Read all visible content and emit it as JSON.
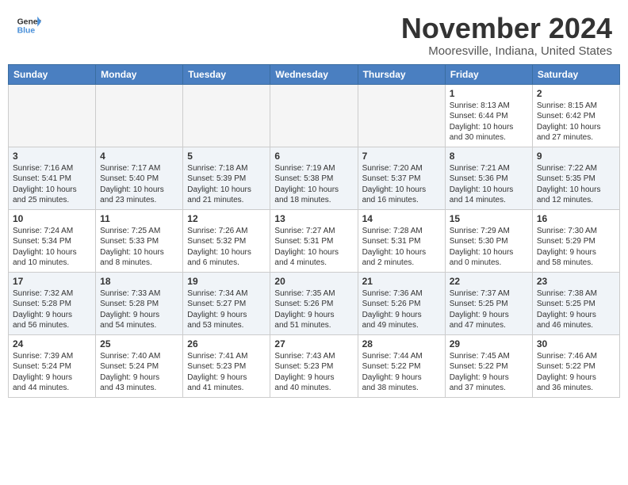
{
  "header": {
    "logo_line1": "General",
    "logo_line2": "Blue",
    "month": "November 2024",
    "location": "Mooresville, Indiana, United States"
  },
  "days_of_week": [
    "Sunday",
    "Monday",
    "Tuesday",
    "Wednesday",
    "Thursday",
    "Friday",
    "Saturday"
  ],
  "weeks": [
    {
      "days": [
        {
          "num": "",
          "info": "",
          "empty": true
        },
        {
          "num": "",
          "info": "",
          "empty": true
        },
        {
          "num": "",
          "info": "",
          "empty": true
        },
        {
          "num": "",
          "info": "",
          "empty": true
        },
        {
          "num": "",
          "info": "",
          "empty": true
        },
        {
          "num": "1",
          "info": "Sunrise: 8:13 AM\nSunset: 6:44 PM\nDaylight: 10 hours\nand 30 minutes."
        },
        {
          "num": "2",
          "info": "Sunrise: 8:15 AM\nSunset: 6:42 PM\nDaylight: 10 hours\nand 27 minutes."
        }
      ]
    },
    {
      "days": [
        {
          "num": "3",
          "info": "Sunrise: 7:16 AM\nSunset: 5:41 PM\nDaylight: 10 hours\nand 25 minutes."
        },
        {
          "num": "4",
          "info": "Sunrise: 7:17 AM\nSunset: 5:40 PM\nDaylight: 10 hours\nand 23 minutes."
        },
        {
          "num": "5",
          "info": "Sunrise: 7:18 AM\nSunset: 5:39 PM\nDaylight: 10 hours\nand 21 minutes."
        },
        {
          "num": "6",
          "info": "Sunrise: 7:19 AM\nSunset: 5:38 PM\nDaylight: 10 hours\nand 18 minutes."
        },
        {
          "num": "7",
          "info": "Sunrise: 7:20 AM\nSunset: 5:37 PM\nDaylight: 10 hours\nand 16 minutes."
        },
        {
          "num": "8",
          "info": "Sunrise: 7:21 AM\nSunset: 5:36 PM\nDaylight: 10 hours\nand 14 minutes."
        },
        {
          "num": "9",
          "info": "Sunrise: 7:22 AM\nSunset: 5:35 PM\nDaylight: 10 hours\nand 12 minutes."
        }
      ]
    },
    {
      "days": [
        {
          "num": "10",
          "info": "Sunrise: 7:24 AM\nSunset: 5:34 PM\nDaylight: 10 hours\nand 10 minutes."
        },
        {
          "num": "11",
          "info": "Sunrise: 7:25 AM\nSunset: 5:33 PM\nDaylight: 10 hours\nand 8 minutes."
        },
        {
          "num": "12",
          "info": "Sunrise: 7:26 AM\nSunset: 5:32 PM\nDaylight: 10 hours\nand 6 minutes."
        },
        {
          "num": "13",
          "info": "Sunrise: 7:27 AM\nSunset: 5:31 PM\nDaylight: 10 hours\nand 4 minutes."
        },
        {
          "num": "14",
          "info": "Sunrise: 7:28 AM\nSunset: 5:31 PM\nDaylight: 10 hours\nand 2 minutes."
        },
        {
          "num": "15",
          "info": "Sunrise: 7:29 AM\nSunset: 5:30 PM\nDaylight: 10 hours\nand 0 minutes."
        },
        {
          "num": "16",
          "info": "Sunrise: 7:30 AM\nSunset: 5:29 PM\nDaylight: 9 hours\nand 58 minutes."
        }
      ]
    },
    {
      "days": [
        {
          "num": "17",
          "info": "Sunrise: 7:32 AM\nSunset: 5:28 PM\nDaylight: 9 hours\nand 56 minutes."
        },
        {
          "num": "18",
          "info": "Sunrise: 7:33 AM\nSunset: 5:28 PM\nDaylight: 9 hours\nand 54 minutes."
        },
        {
          "num": "19",
          "info": "Sunrise: 7:34 AM\nSunset: 5:27 PM\nDaylight: 9 hours\nand 53 minutes."
        },
        {
          "num": "20",
          "info": "Sunrise: 7:35 AM\nSunset: 5:26 PM\nDaylight: 9 hours\nand 51 minutes."
        },
        {
          "num": "21",
          "info": "Sunrise: 7:36 AM\nSunset: 5:26 PM\nDaylight: 9 hours\nand 49 minutes."
        },
        {
          "num": "22",
          "info": "Sunrise: 7:37 AM\nSunset: 5:25 PM\nDaylight: 9 hours\nand 47 minutes."
        },
        {
          "num": "23",
          "info": "Sunrise: 7:38 AM\nSunset: 5:25 PM\nDaylight: 9 hours\nand 46 minutes."
        }
      ]
    },
    {
      "days": [
        {
          "num": "24",
          "info": "Sunrise: 7:39 AM\nSunset: 5:24 PM\nDaylight: 9 hours\nand 44 minutes."
        },
        {
          "num": "25",
          "info": "Sunrise: 7:40 AM\nSunset: 5:24 PM\nDaylight: 9 hours\nand 43 minutes."
        },
        {
          "num": "26",
          "info": "Sunrise: 7:41 AM\nSunset: 5:23 PM\nDaylight: 9 hours\nand 41 minutes."
        },
        {
          "num": "27",
          "info": "Sunrise: 7:43 AM\nSunset: 5:23 PM\nDaylight: 9 hours\nand 40 minutes."
        },
        {
          "num": "28",
          "info": "Sunrise: 7:44 AM\nSunset: 5:22 PM\nDaylight: 9 hours\nand 38 minutes."
        },
        {
          "num": "29",
          "info": "Sunrise: 7:45 AM\nSunset: 5:22 PM\nDaylight: 9 hours\nand 37 minutes."
        },
        {
          "num": "30",
          "info": "Sunrise: 7:46 AM\nSunset: 5:22 PM\nDaylight: 9 hours\nand 36 minutes."
        }
      ]
    }
  ]
}
